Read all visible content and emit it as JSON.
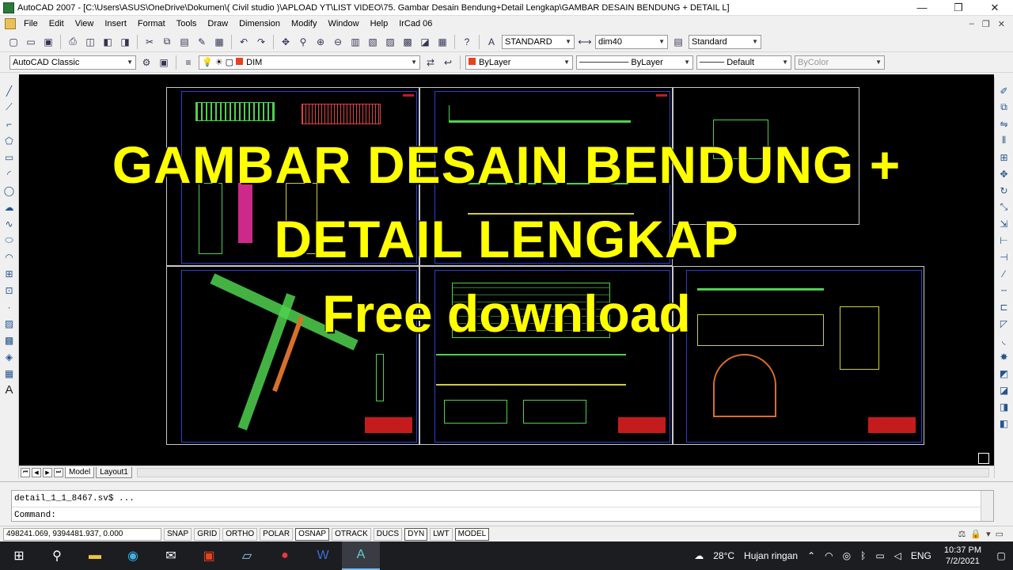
{
  "window": {
    "title": "AutoCAD 2007 - [C:\\Users\\ASUS\\OneDrive\\Dokumen\\( Civil studio )\\APLOAD YT\\LIST VIDEO\\75. Gambar Desain Bendung+Detail Lengkap\\GAMBAR DESAIN BENDUNG + DETAIL L]",
    "minimize": "—",
    "maximize": "❐",
    "close": "✕"
  },
  "menu": {
    "items": [
      "File",
      "Edit",
      "View",
      "Insert",
      "Format",
      "Tools",
      "Draw",
      "Dimension",
      "Modify",
      "Window",
      "Help",
      "IrCad 06"
    ],
    "doc_controls": [
      "–",
      "❐",
      "✕"
    ]
  },
  "toolbar1": {
    "text_style": "STANDARD",
    "dim_style": "dim40",
    "table_style": "Standard"
  },
  "toolbar2": {
    "workspace": "AutoCAD Classic",
    "layer": "DIM",
    "color": "ByLayer",
    "linetype": "ByLayer",
    "lineweight": "Default",
    "plotstyle": "ByColor"
  },
  "colors": {
    "canvas": "#000000",
    "headline": "#ffff00",
    "frame_blue": "#2b3fd0",
    "title_block_red": "#c41c1c",
    "drawing_green": "#4fd14f",
    "layer_color": "#e8431c"
  },
  "overlay": {
    "line1": "GAMBAR DESAIN BENDUNG +",
    "line2": "DETAIL LENGKAP",
    "line3": "Free download"
  },
  "tabs": {
    "model": "Model",
    "layout1": "Layout1"
  },
  "command": {
    "history": "detail_1_1_8467.sv$ ...",
    "prompt": "Command:"
  },
  "status": {
    "coordinates": "498241.069, 9394481.937, 0.000",
    "toggles": [
      "SNAP",
      "GRID",
      "ORTHO",
      "POLAR",
      "OSNAP",
      "OTRACK",
      "DUCS",
      "DYN",
      "LWT",
      "MODEL"
    ],
    "toggles_on": [
      "OSNAP",
      "DYN",
      "MODEL"
    ]
  },
  "taskbar": {
    "weather_temp": "28°C",
    "weather_text": "Hujan ringan",
    "language": "ENG",
    "time": "10:37 PM",
    "date": "7/2/2021"
  }
}
